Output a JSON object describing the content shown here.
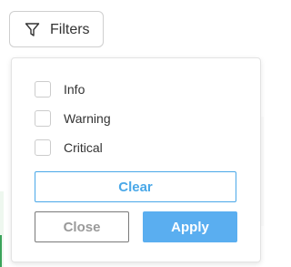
{
  "toolbar": {
    "filters_label": "Filters",
    "filters_icon": "funnel-icon"
  },
  "filter_panel": {
    "options": [
      {
        "label": "Info",
        "checked": false
      },
      {
        "label": "Warning",
        "checked": false
      },
      {
        "label": "Critical",
        "checked": false
      }
    ],
    "clear_label": "Clear",
    "close_label": "Close",
    "apply_label": "Apply"
  },
  "colors": {
    "accent": "#4aa8e8",
    "apply_bg": "#5aaef0",
    "text": "#333333",
    "border": "#cfcfcf"
  }
}
